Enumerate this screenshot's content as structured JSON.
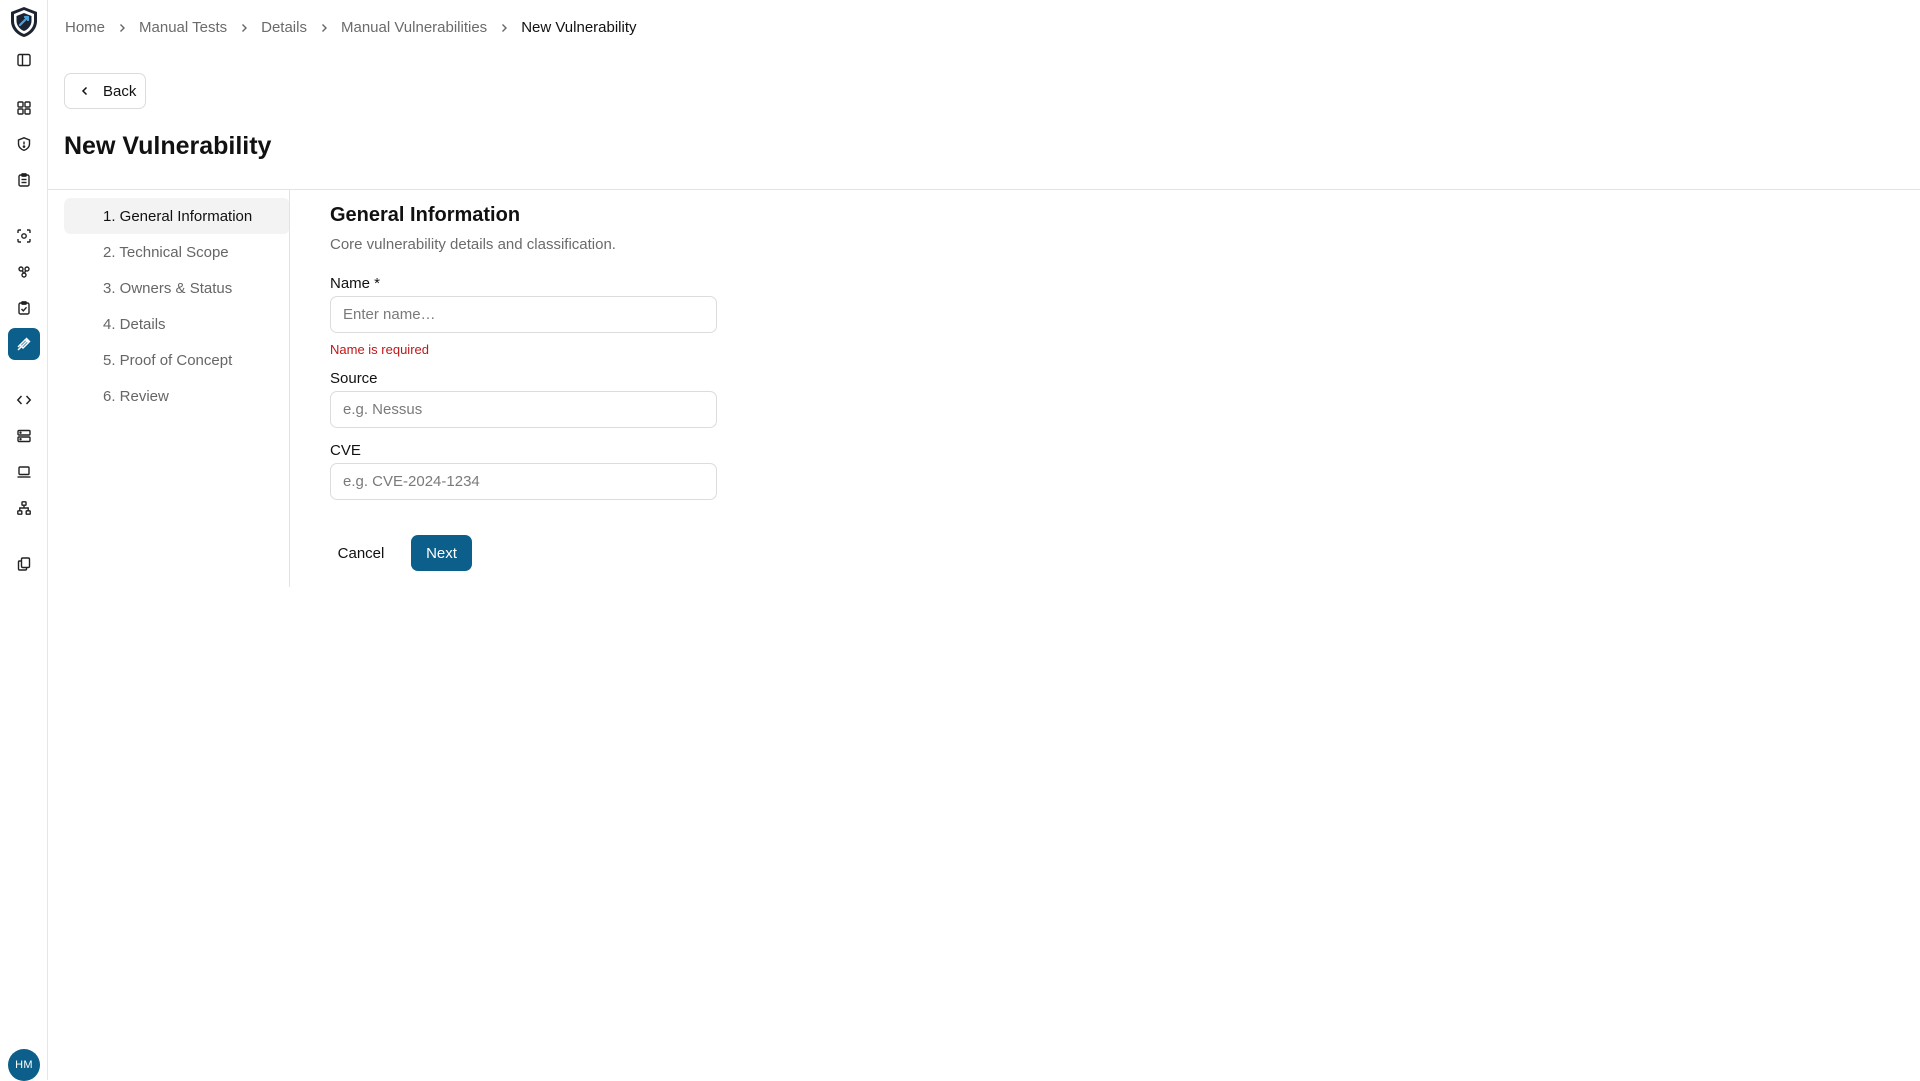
{
  "sidebar": {
    "logo_icon": "shield-logo-icon",
    "items": [
      {
        "icon": "panel-toggle-icon"
      },
      {
        "icon": "dashboard-grid-icon"
      },
      {
        "icon": "shield-alert-icon"
      },
      {
        "icon": "clipboard-list-icon"
      },
      {
        "icon": "scan-focus-icon"
      },
      {
        "icon": "people-group-icon"
      },
      {
        "icon": "clipboard-check-icon"
      },
      {
        "icon": "syringe-icon",
        "active": true
      },
      {
        "icon": "code-icon"
      },
      {
        "icon": "server-icon"
      },
      {
        "icon": "laptop-icon"
      },
      {
        "icon": "network-icon"
      },
      {
        "icon": "copy-documents-icon"
      }
    ],
    "user_initials": "HM",
    "accent_color": "#0b5f8a"
  },
  "breadcrumb": {
    "items": [
      "Home",
      "Manual Tests",
      "Details",
      "Manual Vulnerabilities",
      "New Vulnerability"
    ]
  },
  "back_button": {
    "label": "Back"
  },
  "page_title": "New Vulnerability",
  "steps": [
    {
      "label": "1. General Information",
      "active": true
    },
    {
      "label": "2. Technical Scope"
    },
    {
      "label": "3. Owners & Status"
    },
    {
      "label": "4. Details"
    },
    {
      "label": "5. Proof of Concept"
    },
    {
      "label": "6. Review"
    }
  ],
  "form": {
    "title": "General Information",
    "subtitle": "Core vulnerability details and classification.",
    "name": {
      "label": "Name *",
      "value": "",
      "placeholder": "Enter name…",
      "error": "Name is required"
    },
    "source": {
      "label": "Source",
      "value": "",
      "placeholder": "e.g. Nessus"
    },
    "cve": {
      "label": "CVE",
      "value": "",
      "placeholder": "e.g. CVE-2024-1234"
    },
    "cancel_label": "Cancel",
    "next_label": "Next"
  },
  "colors": {
    "primary": "#0b5f8a",
    "error": "#c01717",
    "muted_text": "#6b6b6b"
  }
}
